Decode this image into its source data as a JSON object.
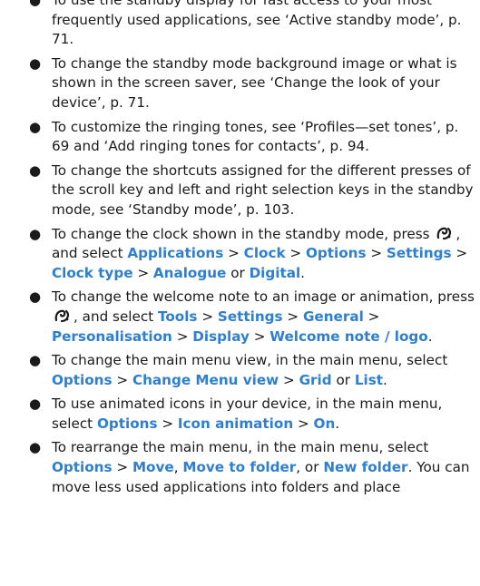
{
  "colors": {
    "text": "#1a1a1a",
    "command": "#2e7fcf"
  },
  "icons": {
    "menu_key": "menu-key-icon"
  },
  "items": [
    {
      "t0": "To use the standby display for fast access to your most frequently used applications, see ‘Active standby mode’, p. 71."
    },
    {
      "t0": "To change the standby mode background image or what is shown in the screen saver, see ‘Change the look of your device’, p. 71."
    },
    {
      "t0": "To customize the ringing tones, see ‘Profiles—set tones’, p. 69 and ‘Add ringing tones for contacts’, p. 94."
    },
    {
      "t0": "To change the shortcuts assigned for the different presses of the scroll key and left and right selection keys in the standby mode, see ‘Standby mode’, p. 103."
    },
    {
      "t0": "To change the clock shown in the standby mode, press",
      "t1": ", and select",
      "c1": "Applications",
      "s1": ">",
      "c2": "Clock",
      "s2": ">",
      "c3": "Options",
      "s3": ">",
      "c4": "Settings",
      "s4": ">",
      "c5": "Clock type",
      "s5": ">",
      "c6": "Analogue",
      "s6": "or",
      "c7": "Digital",
      "end": "."
    },
    {
      "t0": "To change the welcome note to an image or animation, press",
      "t1": ", and select",
      "c1": "Tools",
      "s1": ">",
      "c2": "Settings",
      "s2": ">",
      "c3": "General",
      "s3": ">",
      "c4": "Personalisation",
      "s4": ">",
      "c5": "Display",
      "s5": ">",
      "c6": "Welcome note / logo",
      "end": "."
    },
    {
      "t0": "To change the main menu view, in the main menu, select",
      "c1": "Options",
      "s1": ">",
      "c2": "Change Menu view",
      "s2": ">",
      "c3": "Grid",
      "s3": "or",
      "c4": "List",
      "end": "."
    },
    {
      "t0": "To use animated icons in your device, in the main menu, select",
      "c1": "Options",
      "s1": ">",
      "c2": "Icon animation",
      "s2": ">",
      "c3": "On",
      "end": "."
    },
    {
      "t0": "To rearrange the main menu, in the main menu, select",
      "c1": "Options",
      "s1": ">",
      "c2": "Move",
      "s2": ",",
      "c3": "Move to folder",
      "s3": ", or",
      "c4": "New folder",
      "end": ". You can move less used applications into folders and place"
    }
  ]
}
